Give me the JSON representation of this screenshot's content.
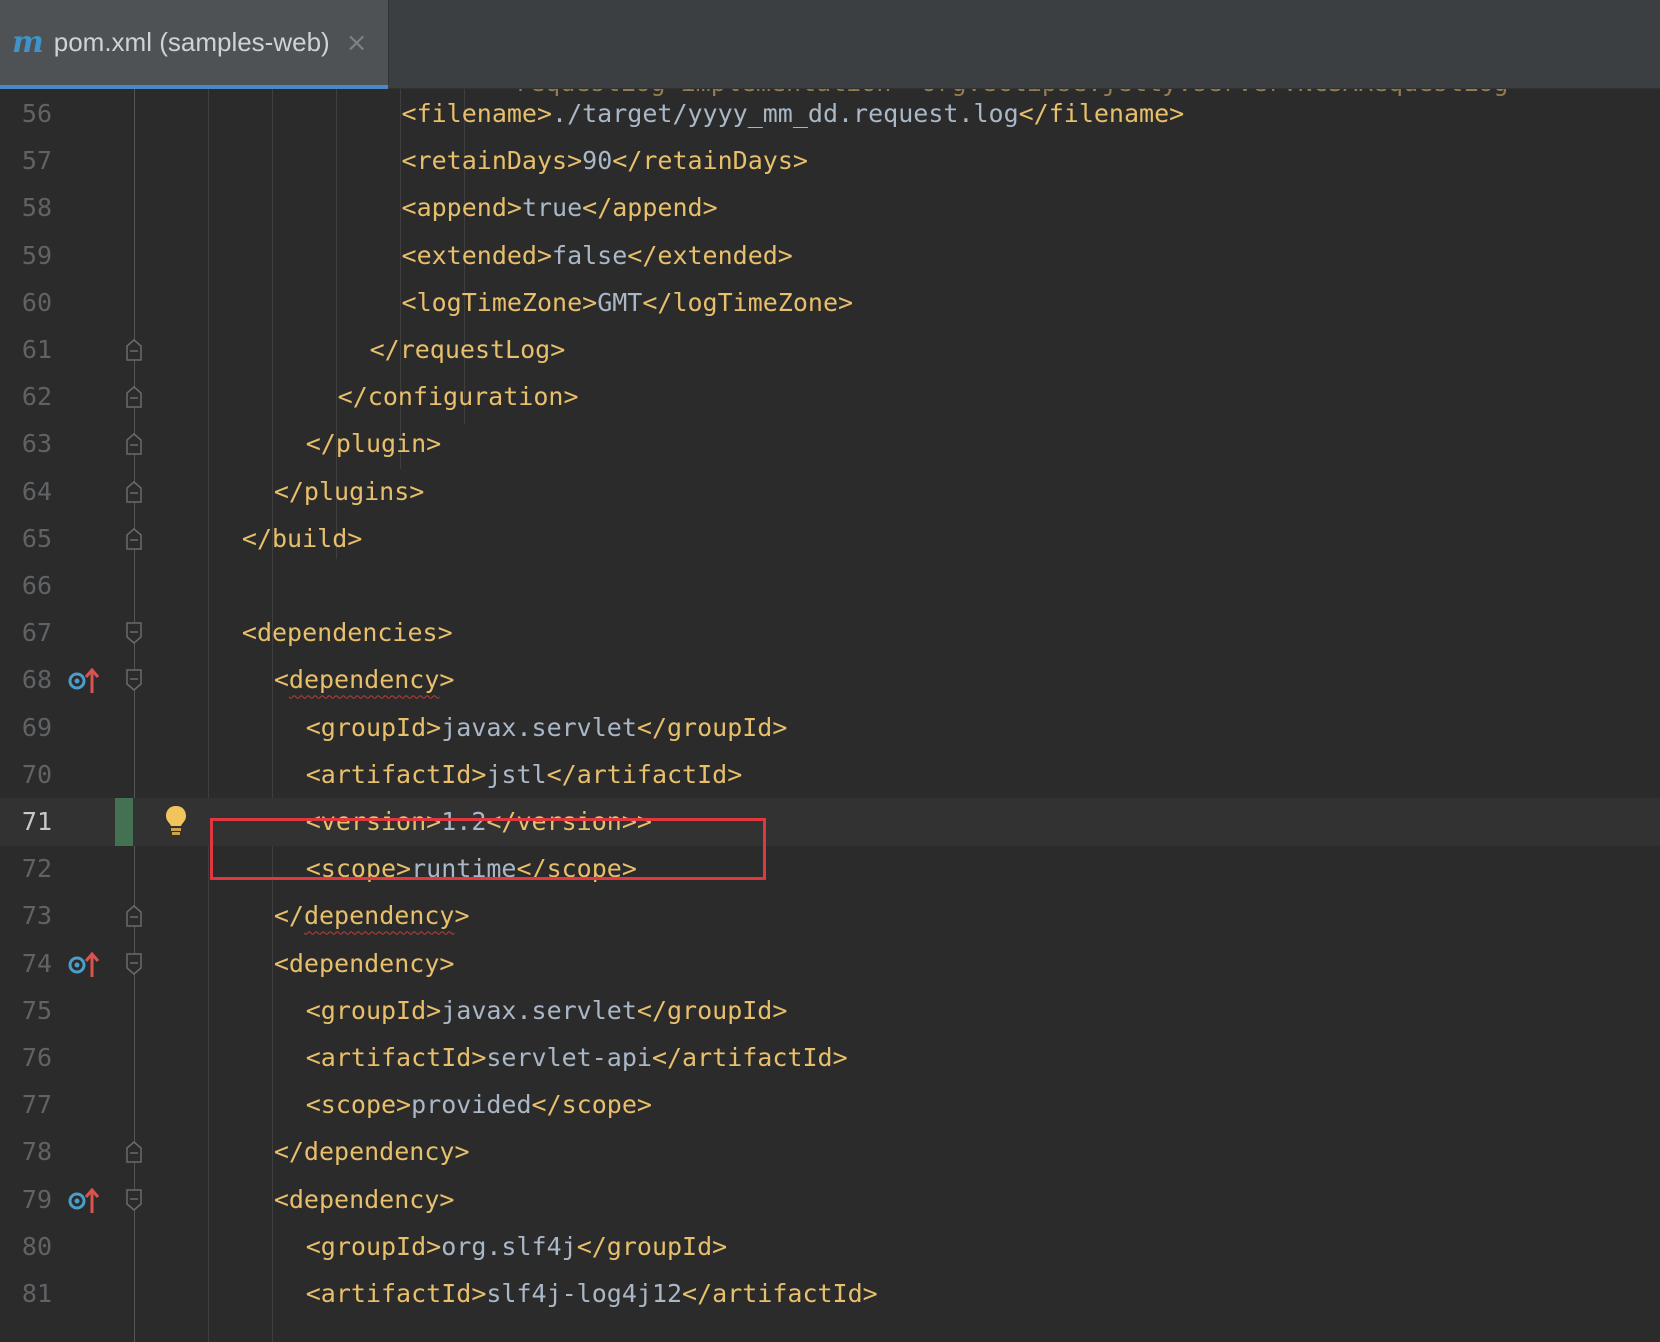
{
  "tab": {
    "icon": "m",
    "title": "pom.xml (samples-web)",
    "close": "×"
  },
  "top_partial": "<requestLog implementation=\"org.eclipse.jetty.server.NCSARequestLog\">",
  "lines": [
    {
      "num": "56",
      "indent": "            ",
      "open": "<filename>",
      "text": "./target/yyyy_mm_dd.request.log",
      "close": "</filename>"
    },
    {
      "num": "57",
      "indent": "            ",
      "open": "<retainDays>",
      "text": "90",
      "close": "</retainDays>"
    },
    {
      "num": "58",
      "indent": "            ",
      "open": "<append>",
      "text": "true",
      "close": "</append>"
    },
    {
      "num": "59",
      "indent": "            ",
      "open": "<extended>",
      "text": "false",
      "close": "</extended>"
    },
    {
      "num": "60",
      "indent": "            ",
      "open": "<logTimeZone>",
      "text": "GMT",
      "close": "</logTimeZone>"
    },
    {
      "num": "61",
      "indent": "          ",
      "open": "</requestLog>",
      "text": "",
      "close": ""
    },
    {
      "num": "62",
      "indent": "        ",
      "open": "</configuration>",
      "text": "",
      "close": ""
    },
    {
      "num": "63",
      "indent": "      ",
      "open": "</plugin>",
      "text": "",
      "close": ""
    },
    {
      "num": "64",
      "indent": "    ",
      "open": "</plugins>",
      "text": "",
      "close": ""
    },
    {
      "num": "65",
      "indent": "  ",
      "open": "</build>",
      "text": "",
      "close": ""
    },
    {
      "num": "66",
      "indent": "",
      "open": "",
      "text": "",
      "close": ""
    },
    {
      "num": "67",
      "indent": "  ",
      "open": "<dependencies>",
      "text": "",
      "close": ""
    },
    {
      "num": "68",
      "indent": "    ",
      "open": "<dependency>",
      "text": "",
      "close": ""
    },
    {
      "num": "69",
      "indent": "      ",
      "open": "<groupId>",
      "text": "javax.servlet",
      "close": "</groupId>"
    },
    {
      "num": "70",
      "indent": "      ",
      "open": "<artifactId>",
      "text": "jstl",
      "close": "</artifactId>"
    },
    {
      "num": "71",
      "indent": "      ",
      "open": "<version>",
      "text": "1.2",
      "close": "</version>>"
    },
    {
      "num": "72",
      "indent": "      ",
      "open": "<scope>",
      "text": "runtime",
      "close": "</scope>"
    },
    {
      "num": "73",
      "indent": "    ",
      "open": "</dependency>",
      "text": "",
      "close": ""
    },
    {
      "num": "74",
      "indent": "    ",
      "open": "<dependency>",
      "text": "",
      "close": ""
    },
    {
      "num": "75",
      "indent": "      ",
      "open": "<groupId>",
      "text": "javax.servlet",
      "close": "</groupId>"
    },
    {
      "num": "76",
      "indent": "      ",
      "open": "<artifactId>",
      "text": "servlet-api",
      "close": "</artifactId>"
    },
    {
      "num": "77",
      "indent": "      ",
      "open": "<scope>",
      "text": "provided",
      "close": "</scope>"
    },
    {
      "num": "78",
      "indent": "    ",
      "open": "</dependency>",
      "text": "",
      "close": ""
    },
    {
      "num": "79",
      "indent": "    ",
      "open": "<dependency>",
      "text": "",
      "close": ""
    },
    {
      "num": "80",
      "indent": "      ",
      "open": "<groupId>",
      "text": "org.slf4j",
      "close": "</groupId>"
    },
    {
      "num": "81",
      "indent": "      ",
      "open": "<artifactId>",
      "text": "slf4j-log4j12",
      "close": "</artifactId>"
    }
  ],
  "current_line": "71",
  "fold_lines": [
    "61",
    "62",
    "63",
    "64",
    "65",
    "67",
    "68",
    "73",
    "74",
    "78",
    "79"
  ],
  "vcs_marker_lines": [
    "68",
    "74",
    "79"
  ],
  "squiggle_lines": [
    "68",
    "73"
  ],
  "colors": {
    "background": "#2b2b2b",
    "tag": "#e8bf6a",
    "text": "#a9b7c6",
    "line_number": "#606366",
    "highlight_box": "#e0383e",
    "changed_bar": "#447152"
  }
}
